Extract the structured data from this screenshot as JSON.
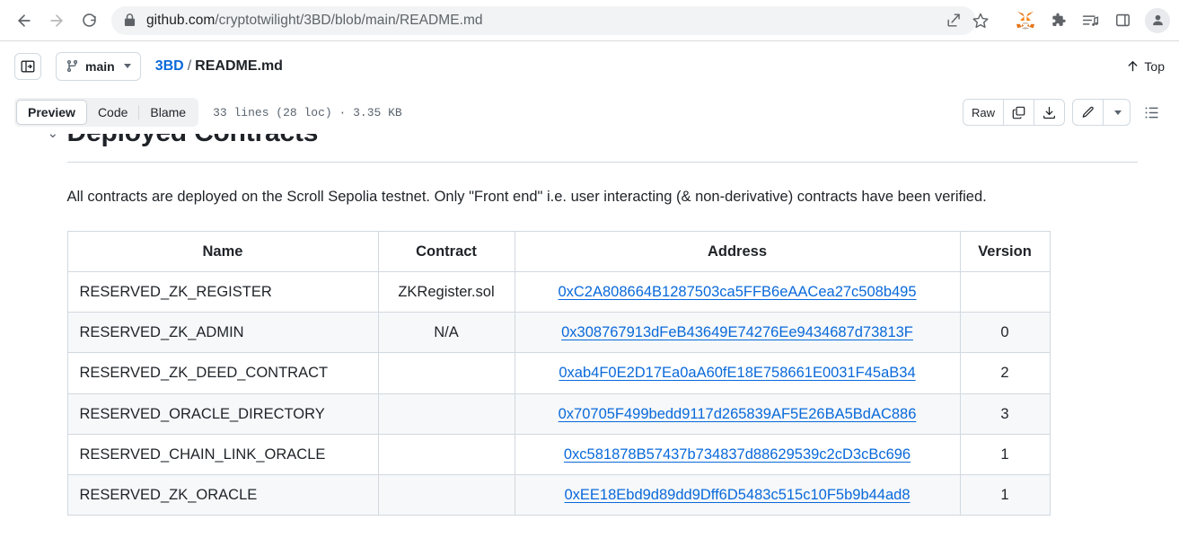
{
  "browser": {
    "back_label": "Back",
    "forward_label": "Forward",
    "reload_label": "Reload",
    "url_protocol_host": "github.com",
    "url_path": "/cryptotwilight/3BD/blob/main/README.md",
    "url_full": "github.com/cryptotwilight/3BD/blob/main/README.md",
    "icons": [
      "share-icon",
      "bookmark-star-icon",
      "metamask-fox-icon",
      "extensions-puzzle-icon",
      "reading-list-icon",
      "side-panel-icon",
      "profile-avatar-icon"
    ]
  },
  "filebar": {
    "sidebar_toggle_label": "Toggle file tree",
    "branch": "main",
    "repo": "3BD",
    "separator": "/",
    "filename": "README.md",
    "top_label": "Top"
  },
  "toolbar": {
    "tabs": [
      {
        "label": "Preview",
        "active": true
      },
      {
        "label": "Code",
        "active": false
      },
      {
        "label": "Blame",
        "active": false
      }
    ],
    "file_meta": "33 lines (28 loc) · 3.35 KB",
    "raw_label": "Raw",
    "copy_label": "Copy raw content",
    "download_label": "Download raw file",
    "edit_label": "Edit this file",
    "edit_dropdown_label": "More edit options",
    "outline_label": "Outline"
  },
  "content": {
    "heading": "Deployed Contracts",
    "anchor_icon": "link-anchor-icon",
    "paragraph": "All contracts are deployed on the Scroll Sepolia testnet. Only \"Front end\" i.e. user interacting (& non-derivative) contracts have been verified.",
    "table": {
      "headers": [
        "Name",
        "Contract",
        "Address",
        "Version"
      ],
      "rows": [
        {
          "name": "RESERVED_ZK_REGISTER",
          "contract": "ZKRegister.sol",
          "address": "0xC2A808664B1287503ca5FFB6eAACea27c508b495",
          "version": ""
        },
        {
          "name": "RESERVED_ZK_ADMIN",
          "contract": "N/A",
          "address": "0x308767913dFeB43649E74276Ee9434687d73813F",
          "version": "0"
        },
        {
          "name": "RESERVED_ZK_DEED_CONTRACT",
          "contract": "",
          "address": "0xab4F0E2D17Ea0aA60fE18E758661E0031F45aB34",
          "version": "2"
        },
        {
          "name": "RESERVED_ORACLE_DIRECTORY",
          "contract": "",
          "address": "0x70705F499bedd9117d265839AF5E26BA5BdAC886",
          "version": "3"
        },
        {
          "name": "RESERVED_CHAIN_LINK_ORACLE",
          "contract": "",
          "address": "0xc581878B57437b734837d88629539c2cD3cBc696",
          "version": "1"
        },
        {
          "name": "RESERVED_ZK_ORACLE",
          "contract": "",
          "address": "0xEE18Ebd9d89dd9Dff6D5483c515c10F5b9b44ad8",
          "version": "1"
        }
      ]
    }
  },
  "colors": {
    "link": "#0969da",
    "text": "#1f2328",
    "muted": "#59636e",
    "border": "#d1d9e0",
    "row_alt": "#f6f8fa"
  }
}
